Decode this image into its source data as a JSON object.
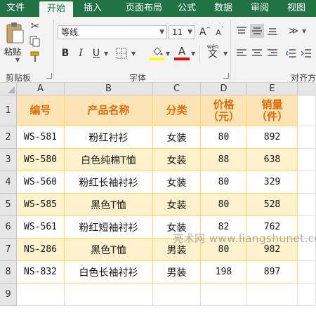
{
  "tabs": [
    {
      "label": "文件",
      "active": false
    },
    {
      "label": "开始",
      "active": true
    },
    {
      "label": "插入",
      "active": false
    },
    {
      "label": "页面布局",
      "active": false
    },
    {
      "label": "公式",
      "active": false
    },
    {
      "label": "数据",
      "active": false
    },
    {
      "label": "审阅",
      "active": false
    },
    {
      "label": "视图",
      "active": false
    }
  ],
  "ribbon": {
    "clipboard": {
      "paste_label": "粘贴",
      "group_label": "剪贴板"
    },
    "font": {
      "font_name": "等线",
      "font_size": "11",
      "bold": "B",
      "italic": "I",
      "underline": "U",
      "grow": "A",
      "shrink": "A",
      "font_color_glyph": "A",
      "phonetic_top": "wén",
      "phonetic_bottom": "文",
      "group_label": "字体",
      "fill_color": "#ffff00",
      "font_color": "#ff0000"
    },
    "alignment": {
      "group_label": "对齐方"
    }
  },
  "sheet": {
    "columns": [
      "A",
      "B",
      "C",
      "D",
      "E"
    ],
    "rows": [
      "1",
      "2",
      "3",
      "4",
      "5",
      "6",
      "7",
      "8",
      "9"
    ],
    "header": [
      "编号",
      "产品名称",
      "分类",
      "价格\n（元）",
      "销量\n（件）"
    ],
    "data": [
      [
        "WS-581",
        "粉红衬衫",
        "女装",
        "80",
        "892"
      ],
      [
        "WS-580",
        "白色纯棉T恤",
        "女装",
        "88",
        "638"
      ],
      [
        "WS-560",
        "粉红长袖衬衫",
        "女装",
        "80",
        "329"
      ],
      [
        "WS-585",
        "黑色T恤",
        "女装",
        "80",
        "528"
      ],
      [
        "WS-561",
        "粉红短袖衬衫",
        "女装",
        "82",
        "762"
      ],
      [
        "NS-286",
        "黑色T恤",
        "男装",
        "80",
        "982"
      ],
      [
        "NS-832",
        "白色长袖衬衫",
        "男装",
        "198",
        "897"
      ]
    ],
    "header_color": "#e26b0a",
    "header_fill": "#fce4b4",
    "stripe_fill": "#fff2cc",
    "border_color": "#ffd966"
  },
  "watermark": "亮术网 www.liangshunet.com"
}
